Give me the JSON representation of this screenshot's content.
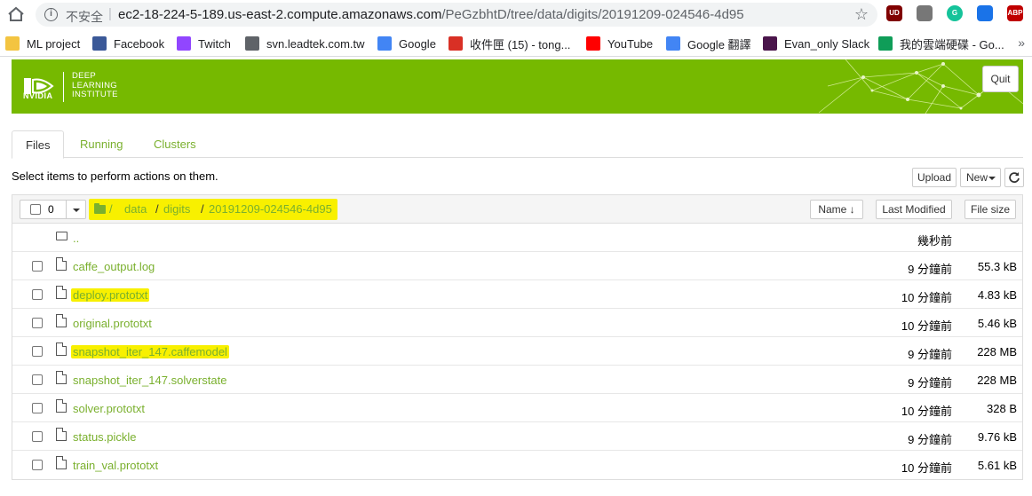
{
  "browser": {
    "insecure_label": "不安全",
    "url_host": "ec2-18-224-5-189.us-east-2.compute.amazonaws.com",
    "url_path": "/PeGzbhtD/tree/data/digits/20191209-024546-4d95",
    "extensions": [
      {
        "icon": "ublock-icon",
        "color": "#800000",
        "text": "UD"
      },
      {
        "icon": "cloud-ext-icon",
        "color": "#777777",
        "text": ""
      },
      {
        "icon": "grammarly-icon",
        "color": "#15c39a",
        "text": "G"
      },
      {
        "icon": "bell-ext-icon",
        "color": "#1a73e8",
        "text": ""
      },
      {
        "icon": "adblock-icon",
        "color": "#c00000",
        "text": "ABP"
      }
    ],
    "bookmarks": [
      {
        "label": "ML project",
        "icon": "folder-bookmark-icon",
        "color": "#f3c441"
      },
      {
        "label": "Facebook",
        "icon": "facebook-icon",
        "color": "#3b5998"
      },
      {
        "label": "Twitch",
        "icon": "twitch-icon",
        "color": "#9146ff"
      },
      {
        "label": "svn.leadtek.com.tw",
        "icon": "globe-icon",
        "color": "#5f6368"
      },
      {
        "label": "Google",
        "icon": "google-icon",
        "color": "#4285f4"
      },
      {
        "label": "收件匣 (15) - tong...",
        "icon": "gmail-icon",
        "color": "#d93025"
      },
      {
        "label": "YouTube",
        "icon": "youtube-icon",
        "color": "#ff0000"
      },
      {
        "label": "Google 翻譯",
        "icon": "translate-icon",
        "color": "#4285f4"
      },
      {
        "label": "Evan_only Slack",
        "icon": "slack-icon",
        "color": "#4a154b"
      },
      {
        "label": "我的雲端硬碟 - Go...",
        "icon": "drive-icon",
        "color": "#0f9d58"
      }
    ],
    "more_label": "»"
  },
  "header": {
    "brand": "NVIDIA",
    "dli_lines": [
      "DEEP",
      "LEARNING",
      "INSTITUTE"
    ],
    "quit_label": "Quit",
    "accent_color": "#76b900"
  },
  "tabs": [
    {
      "label": "Files",
      "active": true
    },
    {
      "label": "Running",
      "active": false
    },
    {
      "label": "Clusters",
      "active": false
    }
  ],
  "toolbar": {
    "hint": "Select items to perform actions on them.",
    "upload_label": "Upload",
    "new_label": "New",
    "refresh_icon": "refresh-icon"
  },
  "list_header": {
    "selected_count": "0",
    "breadcrumb": [
      "/",
      "data",
      "digits",
      "20191209-024546-4d95"
    ],
    "sort_name_label": "Name",
    "last_modified_label": "Last Modified",
    "file_size_label": "File size"
  },
  "files": [
    {
      "name": "..",
      "type": "folder",
      "modified": "幾秒前",
      "size": "",
      "highlighted": false
    },
    {
      "name": "caffe_output.log",
      "type": "file",
      "modified": "9 分鐘前",
      "size": "55.3 kB",
      "highlighted": false
    },
    {
      "name": "deploy.prototxt",
      "type": "file",
      "modified": "10 分鐘前",
      "size": "4.83 kB",
      "highlighted": true
    },
    {
      "name": "original.prototxt",
      "type": "file",
      "modified": "10 分鐘前",
      "size": "5.46 kB",
      "highlighted": false
    },
    {
      "name": "snapshot_iter_147.caffemodel",
      "type": "file",
      "modified": "9 分鐘前",
      "size": "228 MB",
      "highlighted": true
    },
    {
      "name": "snapshot_iter_147.solverstate",
      "type": "file",
      "modified": "9 分鐘前",
      "size": "228 MB",
      "highlighted": false
    },
    {
      "name": "solver.prototxt",
      "type": "file",
      "modified": "10 分鐘前",
      "size": "328 B",
      "highlighted": false
    },
    {
      "name": "status.pickle",
      "type": "file",
      "modified": "9 分鐘前",
      "size": "9.76 kB",
      "highlighted": false
    },
    {
      "name": "train_val.prototxt",
      "type": "file",
      "modified": "10 分鐘前",
      "size": "5.61 kB",
      "highlighted": false
    }
  ]
}
